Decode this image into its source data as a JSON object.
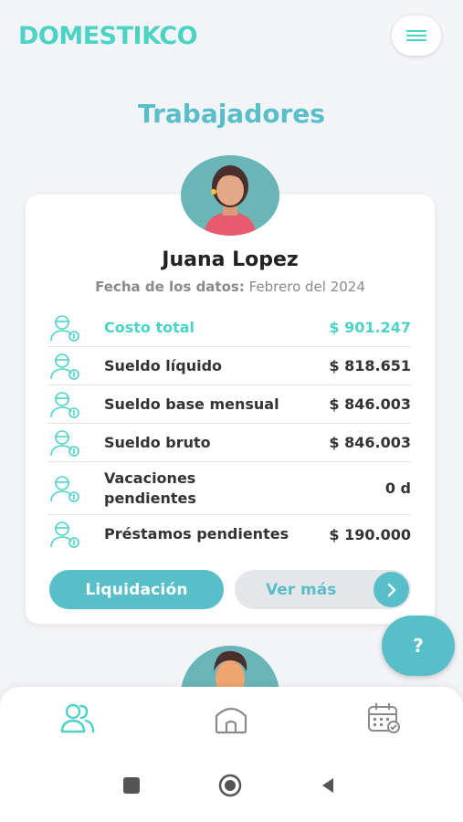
{
  "app": {
    "logo": "DOMESTIKCO"
  },
  "page": {
    "title": "Trabajadores"
  },
  "worker": {
    "name": "Juana Lopez",
    "date_label": "Fecha de los datos:",
    "date_value": "Febrero del 2024",
    "rows": [
      {
        "label": "Costo total",
        "value": "$ 901.247",
        "highlight": true,
        "icon": "worker-money-icon"
      },
      {
        "label": "Sueldo líquido",
        "value": "$ 818.651",
        "icon": "worker-money-icon"
      },
      {
        "label": "Sueldo base mensual",
        "value": "$ 846.003",
        "icon": "worker-money-icon"
      },
      {
        "label": "Sueldo bruto",
        "value": "$ 846.003",
        "icon": "worker-money-icon"
      },
      {
        "label": "Vacaciones pendientes",
        "label_line1": "Vacaciones",
        "label_line2": "pendientes",
        "value": "0 d",
        "icon": "worker-money-icon"
      },
      {
        "label": "Préstamos pendientes",
        "value": "$ 190.000",
        "icon": "worker-money-icon"
      }
    ],
    "buttons": {
      "liquidacion": "Liquidación",
      "ver_mas": "Ver más"
    }
  },
  "help": {
    "label": "?"
  },
  "bottom_nav": {
    "items": [
      "workers-icon",
      "home-icon",
      "calendar-icon"
    ]
  },
  "colors": {
    "accent": "#4cd3c6",
    "primary": "#58bfc8",
    "background": "#f3f4f7"
  }
}
